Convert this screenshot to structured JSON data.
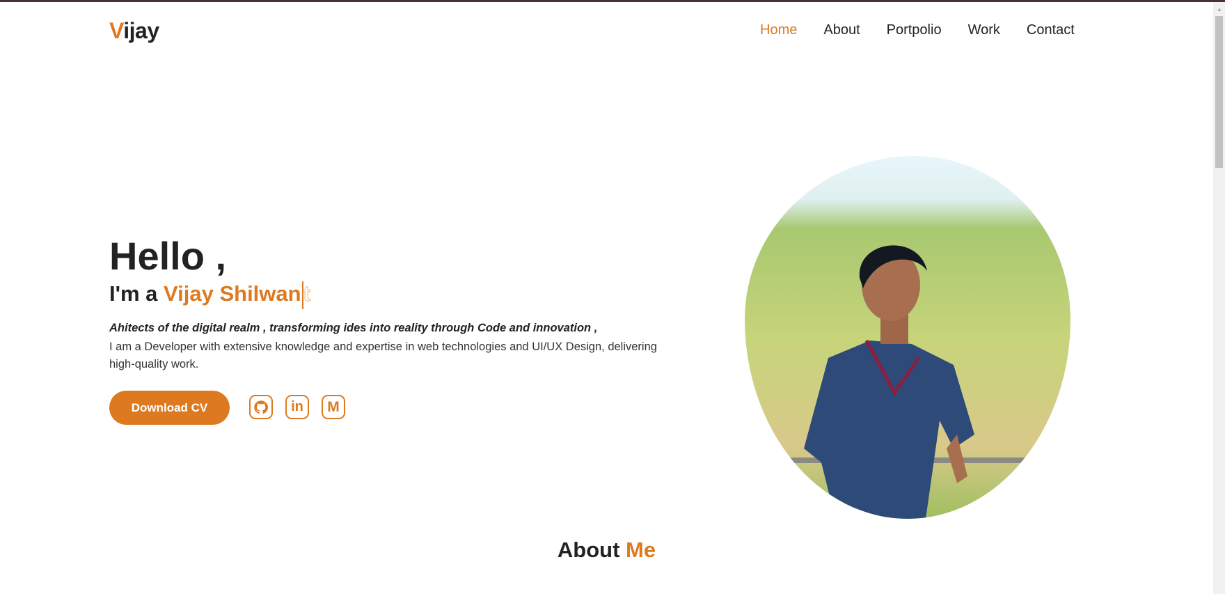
{
  "logo": {
    "first": "V",
    "rest": "ijay"
  },
  "nav": {
    "items": [
      {
        "label": "Home",
        "active": true
      },
      {
        "label": "About"
      },
      {
        "label": "Portpolio"
      },
      {
        "label": "Work"
      },
      {
        "label": "Contact"
      }
    ]
  },
  "hero": {
    "greeting": "Hello ,",
    "intro": "I'm a ",
    "name_typed": "Vijay Shilwan",
    "name_pending": "t",
    "tagline": "Ahitects of the digital realm , transforming ides into reality through Code and innovation ,",
    "description": "I am a Developer with extensive knowledge and expertise in web technologies and UI/UX Design, delivering high-quality work.",
    "cta": "Download CV",
    "socials": [
      "github-icon",
      "linkedin-icon",
      "gmail-icon"
    ]
  },
  "about": {
    "title": "About",
    "accent": "Me"
  },
  "colors": {
    "accent": "#dd7a1f",
    "text": "#222222"
  }
}
